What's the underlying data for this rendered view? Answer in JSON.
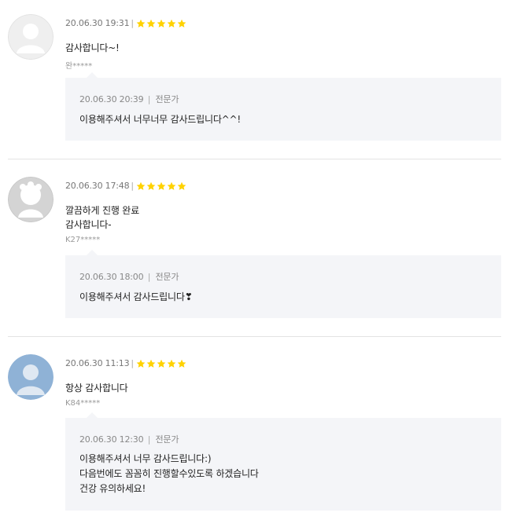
{
  "star_color": "#ffd200",
  "reviews": [
    {
      "date": "20.06.30 19:31",
      "rating": 5,
      "text": "감사합니다~!",
      "author": "완*****",
      "avatar_icon": "default-avatar-icon",
      "reply": {
        "date": "20.06.30 20:39",
        "role": "전문가",
        "text": "이용해주셔서 너무너무 감사드립니다^^!"
      }
    },
    {
      "date": "20.06.30 17:48",
      "rating": 5,
      "text": "깔끔하게 진행 완료\n감사합니다-",
      "author": "K27*****",
      "avatar_icon": "character-avatar-icon",
      "reply": {
        "date": "20.06.30 18:00",
        "role": "전문가",
        "text": "이용해주셔서 감사드립니다❣"
      }
    },
    {
      "date": "20.06.30 11:13",
      "rating": 5,
      "text": "항상 감사합니다",
      "author": "K84*****",
      "avatar_icon": "blue-person-avatar-icon",
      "reply": {
        "date": "20.06.30 12:30",
        "role": "전문가",
        "text": "이용해주셔서 너무 감사드립니다:)\n다음번에도 꼼꼼히 진행할수있도록 하겠습니다\n건강 유의하세요!"
      }
    }
  ]
}
